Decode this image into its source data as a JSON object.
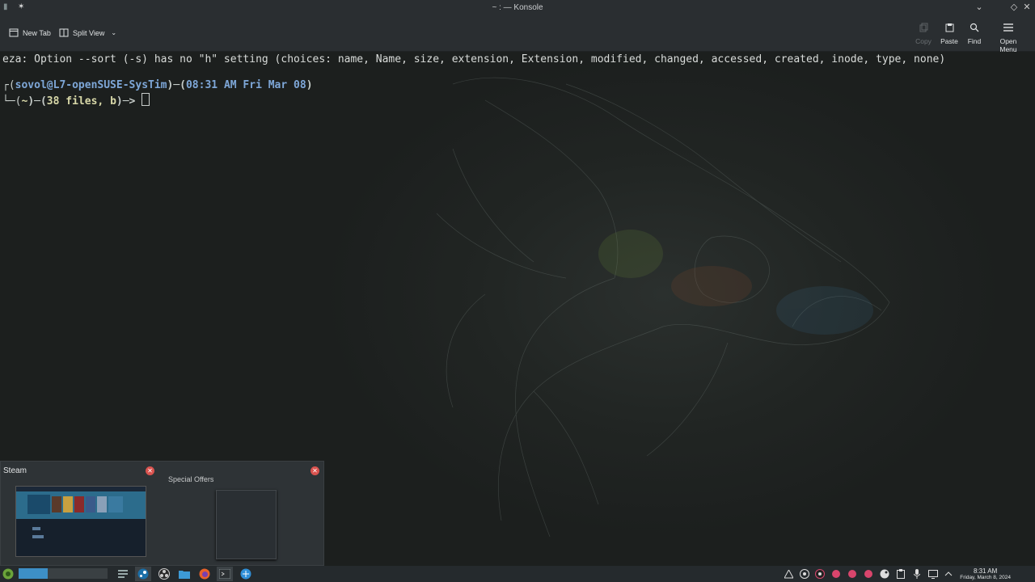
{
  "window": {
    "title": "~ : — Konsole"
  },
  "toolbar": {
    "new_tab": "New Tab",
    "split_view": "Split View",
    "copy": "Copy",
    "paste": "Paste",
    "find": "Find",
    "open_menu": "Open Menu"
  },
  "terminal": {
    "error_line": "eza: Option --sort (-s) has no \"h\" setting (choices: name, Name, size, extension, Extension, modified, changed, accessed, created, inode, type, none)",
    "prompt_user": "sovol@L7-openSUSE-SysTim",
    "prompt_time": "08:31 AM Fri Mar 08",
    "prompt_dir": "~",
    "prompt_files": "38 files, b"
  },
  "preview": {
    "app_title": "Steam",
    "second_title": "Special Offers"
  },
  "taskbar": {
    "clock_time": "8:31 AM",
    "clock_date": "Friday, March 8, 2024",
    "icons": [
      "app-launcher-icon",
      "task-manager-icon",
      "steam-icon",
      "obs-icon",
      "file-manager-icon",
      "firefox-icon",
      "konsole-icon",
      "browser-icon"
    ],
    "accent": "#d9456c"
  }
}
